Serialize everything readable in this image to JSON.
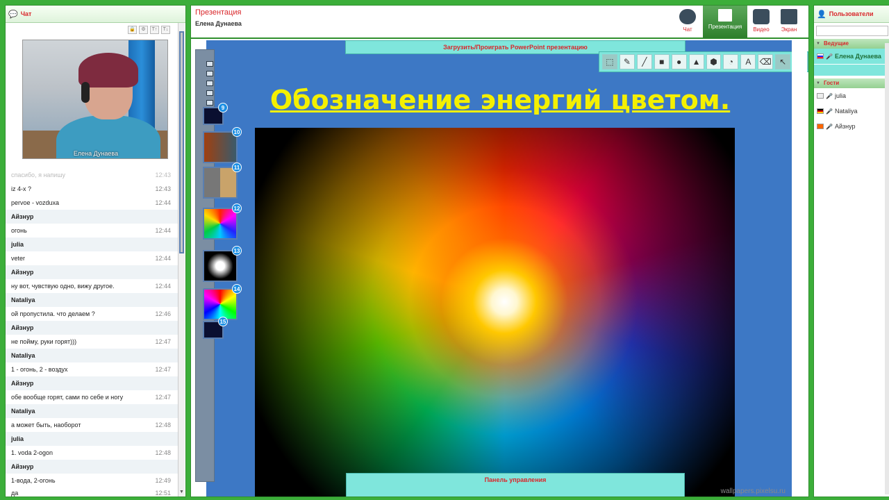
{
  "chat": {
    "title": "Чат",
    "tools": [
      "🔒",
      "⚙",
      "T↑",
      "T↓"
    ],
    "video_caption": "Елена Дунаева",
    "messages": [
      {
        "text": "спасибо, я напишу",
        "time": "12:43",
        "kind": "faded"
      },
      {
        "text": "iz 4-x ?",
        "time": "12:43",
        "kind": "msg"
      },
      {
        "text": "pervoe - vozduxa",
        "time": "12:44",
        "kind": "msg"
      },
      {
        "text": "Айзнур",
        "time": "",
        "kind": "author"
      },
      {
        "text": "огонь",
        "time": "12:44",
        "kind": "msg"
      },
      {
        "text": "julia",
        "time": "",
        "kind": "author"
      },
      {
        "text": "veter",
        "time": "12:44",
        "kind": "msg"
      },
      {
        "text": "Айзнур",
        "time": "",
        "kind": "author"
      },
      {
        "text": "ну вот, чувствую одно, вижу другое.",
        "time": "12:44",
        "kind": "msg"
      },
      {
        "text": "Nataliya",
        "time": "",
        "kind": "author"
      },
      {
        "text": "ой пропустила. что делаем ?",
        "time": "12:46",
        "kind": "msg"
      },
      {
        "text": "Айзнур",
        "time": "",
        "kind": "author"
      },
      {
        "text": "не пойму, руки горят)))",
        "time": "12:47",
        "kind": "msg"
      },
      {
        "text": "Nataliya",
        "time": "",
        "kind": "author"
      },
      {
        "text": "1 - огонь, 2 - воздух",
        "time": "12:47",
        "kind": "msg"
      },
      {
        "text": "Айзнур",
        "time": "",
        "kind": "author"
      },
      {
        "text": "обе вообще горят, сами по себе и ногу",
        "time": "12:47",
        "kind": "msg"
      },
      {
        "text": "Nataliya",
        "time": "",
        "kind": "author"
      },
      {
        "text": "а может быть, наоборот",
        "time": "12:48",
        "kind": "msg"
      },
      {
        "text": "julia",
        "time": "",
        "kind": "author"
      },
      {
        "text": "1. voda 2-ogon",
        "time": "12:48",
        "kind": "msg"
      },
      {
        "text": "Айзнур",
        "time": "",
        "kind": "author"
      },
      {
        "text": "1-вода, 2-огонь",
        "time": "12:49",
        "kind": "msg"
      },
      {
        "text": "да",
        "time": "12:51",
        "kind": "msg"
      }
    ]
  },
  "presentation": {
    "title": "Презентация",
    "presenter": "Елена Дунаева",
    "upload_label": "Загрузить/Проиграть PowerPoint презентацию",
    "slide_title": "Обозначение энергий цветом.",
    "watermark": "wallpapers.pixelsu.ru",
    "control_panel_label": "Панель управления",
    "thumbnails": [
      "9",
      "10",
      "11",
      "12",
      "13",
      "14",
      "15"
    ]
  },
  "modes": [
    {
      "label": "Чат",
      "icon": "chat-bubble-icon"
    },
    {
      "label": "Презентация",
      "icon": "presentation-icon"
    },
    {
      "label": "Видео",
      "icon": "video-camera-icon"
    },
    {
      "label": "Экран",
      "icon": "monitor-icon"
    }
  ],
  "draw_tools": [
    "⬚",
    "✎",
    "╱",
    "■",
    "●",
    "▲",
    "⬢",
    "◔",
    "A",
    "⌫",
    "↖",
    "▤"
  ],
  "users": {
    "title": "Пользователи",
    "groups": [
      {
        "label": "Ведущие",
        "members": [
          "Елена Дунаева"
        ]
      },
      {
        "label": "Гости",
        "members": [
          "julia",
          "Nataliya",
          "Айзнур"
        ]
      }
    ]
  },
  "colors": {
    "accent_green": "#3cae3a",
    "header_red": "#d9262a",
    "panel_cyan": "#7fe6dc",
    "slide_blue": "#3d78c5",
    "title_yellow": "#f4f000"
  }
}
